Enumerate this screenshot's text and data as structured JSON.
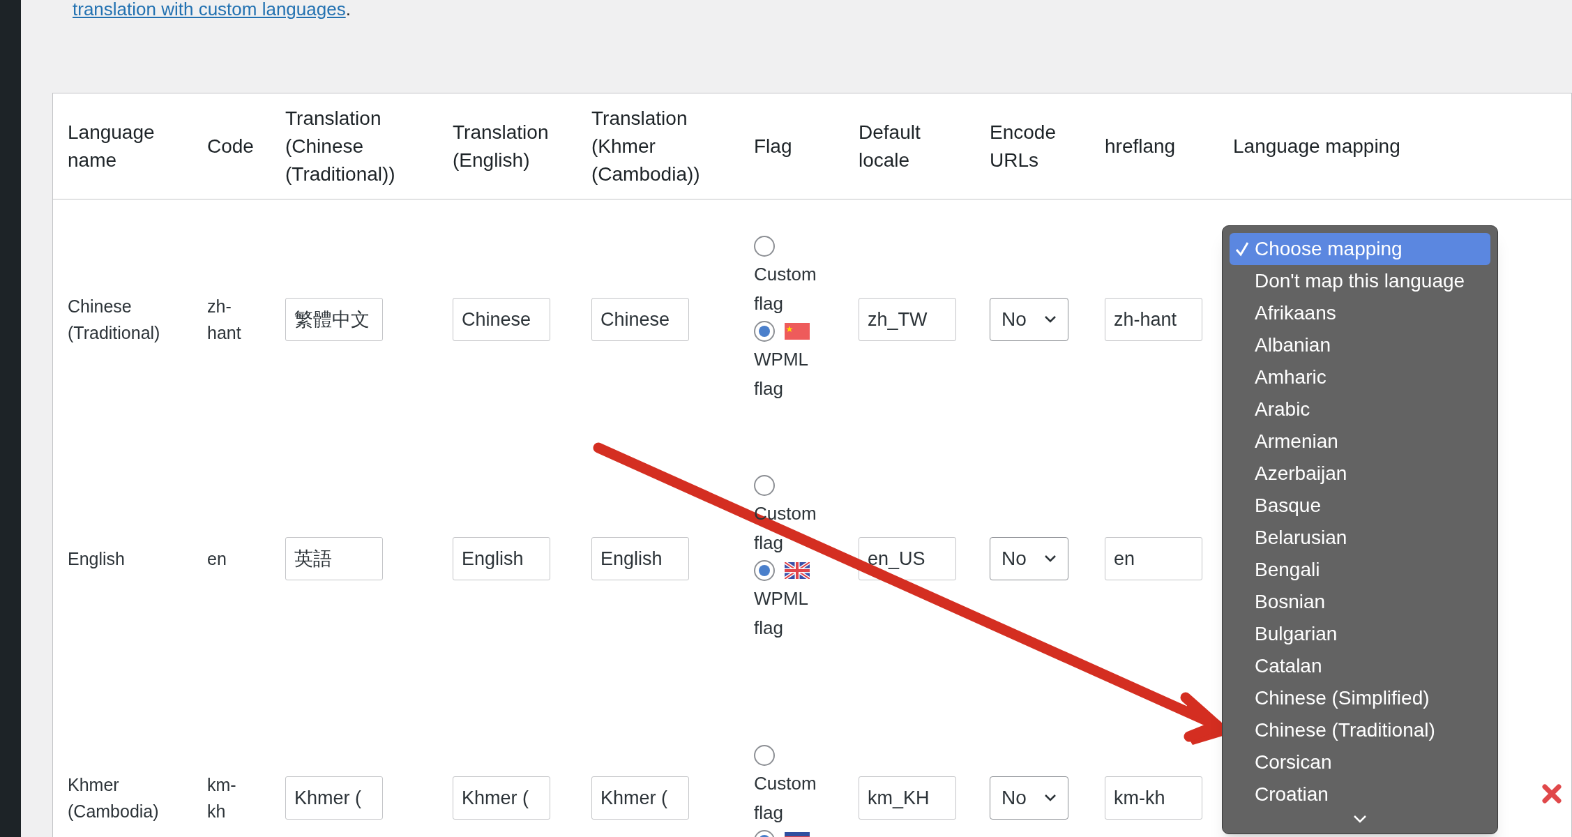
{
  "intro_link": {
    "text": "translation with custom languages",
    "suffix": "."
  },
  "table": {
    "columns": [
      "Language name",
      "Code",
      "Translation (Chinese (Traditional))",
      "Translation (English)",
      "Translation (Khmer (Cambodia))",
      "Flag",
      "Default locale",
      "Encode URLs",
      "hreflang",
      "Language mapping"
    ],
    "rows": [
      {
        "name": "Chinese (Traditional)",
        "code": "zh-hant",
        "translations": [
          "繁體中文",
          "Chinese",
          "Chinese"
        ],
        "flag": {
          "custom_label": "Custom flag",
          "custom_selected": false,
          "wpml_selected": true,
          "wpml_label": "WPML flag",
          "kind": "china"
        },
        "default_locale": "zh_TW",
        "encode_urls": "No",
        "hreflang": "zh-hant",
        "delete_icon": false
      },
      {
        "name": "English",
        "code": "en",
        "translations": [
          "英語",
          "English",
          "English"
        ],
        "flag": {
          "custom_label": "Custom flag",
          "custom_selected": false,
          "wpml_selected": true,
          "wpml_label": "WPML flag",
          "kind": "uk"
        },
        "default_locale": "en_US",
        "encode_urls": "No",
        "hreflang": "en",
        "delete_icon": false
      },
      {
        "name": "Khmer (Cambodia)",
        "code": "km-kh",
        "translations": [
          "Khmer (",
          "Khmer (",
          "Khmer ("
        ],
        "flag": {
          "custom_label": "Custom flag",
          "custom_selected": false,
          "wpml_selected": true,
          "kind": "cambodia"
        },
        "default_locale": "km_KH",
        "encode_urls": "No",
        "hreflang": "km-kh",
        "delete_icon": true
      }
    ]
  },
  "mapping_dropdown": {
    "options": [
      {
        "label": "Choose mapping",
        "selected": true
      },
      {
        "label": "Don't map this language",
        "selected": false
      },
      {
        "label": "Afrikaans",
        "selected": false
      },
      {
        "label": "Albanian",
        "selected": false
      },
      {
        "label": "Amharic",
        "selected": false
      },
      {
        "label": "Arabic",
        "selected": false
      },
      {
        "label": "Armenian",
        "selected": false
      },
      {
        "label": "Azerbaijan",
        "selected": false
      },
      {
        "label": "Basque",
        "selected": false
      },
      {
        "label": "Belarusian",
        "selected": false
      },
      {
        "label": "Bengali",
        "selected": false
      },
      {
        "label": "Bosnian",
        "selected": false
      },
      {
        "label": "Bulgarian",
        "selected": false
      },
      {
        "label": "Catalan",
        "selected": false
      },
      {
        "label": "Chinese (Simplified)",
        "selected": false
      },
      {
        "label": "Chinese (Traditional)",
        "selected": false
      },
      {
        "label": "Corsican",
        "selected": false
      },
      {
        "label": "Croatian",
        "selected": false
      }
    ]
  }
}
